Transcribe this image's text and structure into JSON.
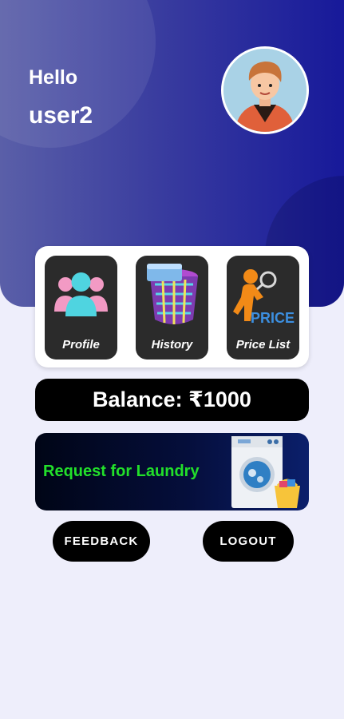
{
  "header": {
    "greeting": "Hello",
    "username": "user2"
  },
  "menu": {
    "tiles": [
      {
        "label": "Profile",
        "icon": "users-icon"
      },
      {
        "label": "History",
        "icon": "laundry-basket-icon"
      },
      {
        "label": "Price List",
        "icon": "price-magnifier-icon",
        "icon_text": "PRICE"
      }
    ]
  },
  "balance": {
    "text": "Balance: ₹1000"
  },
  "request": {
    "text": "Request for Laundry",
    "icon": "washing-machine-icon",
    "text_color": "#22e02a"
  },
  "buttons": {
    "feedback": "FEEDBACK",
    "logout": "LOGOUT"
  },
  "colors": {
    "header_start": "#5a5fa8",
    "header_end": "#17199a",
    "background": "#eeeefb"
  }
}
